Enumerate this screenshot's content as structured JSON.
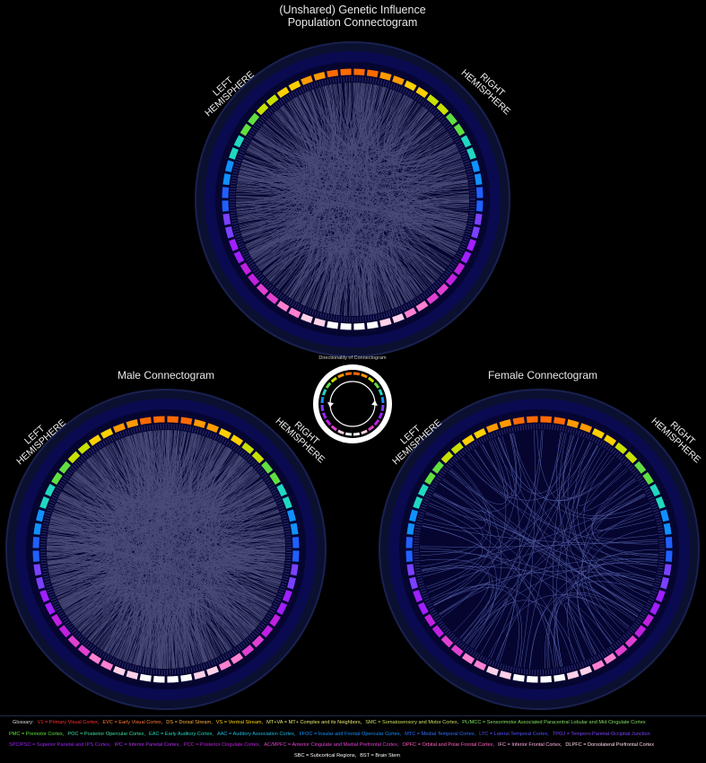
{
  "titles": {
    "main_line1": "(Unshared) Genetic Influence",
    "main_line2": "Population Connectogram",
    "male": "Male Connectogram",
    "female": "Female Connectogram",
    "directionality": "Directionality of Connectogram"
  },
  "hemispheres": {
    "left": "LEFT\nHEMISPHERE",
    "right": "RIGHT\nHEMISPHERE"
  },
  "connectograms": [
    {
      "name": "population",
      "edge_density": 0.75
    },
    {
      "name": "male",
      "edge_density": 1.0
    },
    {
      "name": "female",
      "edge_density": 0.12
    }
  ],
  "segment_colors": [
    "#ff6a00",
    "#ff9a00",
    "#ffd000",
    "#c8e000",
    "#60e040",
    "#20d8c0",
    "#1090ff",
    "#2060ff",
    "#7a40ff",
    "#a020ff",
    "#c020e0",
    "#e040d0",
    "#ff80d0",
    "#ffd0e8",
    "#ffffff"
  ],
  "glossary": {
    "prefix": "Glossary:",
    "line1": [
      {
        "text": "V1 = Primary Visual Cortex,",
        "color": "#ff3030"
      },
      {
        "text": "EVC = Early Visual Cortex,",
        "color": "#ff7a30"
      },
      {
        "text": "DS = Dorsal Stream,",
        "color": "#ffb040"
      },
      {
        "text": "VS = Ventral Stream,",
        "color": "#ffd000"
      },
      {
        "text": "MT+VA = MT+ Complex and its Neighbors,",
        "color": "#e8e870"
      },
      {
        "text": "SMC = Somatosensory and Motor Cortex,",
        "color": "#c8e060"
      },
      {
        "text": "PL/MCC = Sensorimotor Associated Paracentral Lobular and Mid Cingulate Cortex",
        "color": "#80e060"
      }
    ],
    "line2": [
      {
        "text": "PMC = Premotor Cortex,",
        "color": "#60e040"
      },
      {
        "text": "POC = Posterior Opercular Cortex,",
        "color": "#40e0a0"
      },
      {
        "text": "EAC = Early Auditory Cortex,",
        "color": "#20d8c0"
      },
      {
        "text": "AAC = Auditory Association Cortex,",
        "color": "#20b8e0"
      },
      {
        "text": "I/FOC = Insular and Frontal Opercular Cortex,",
        "color": "#1090ff"
      },
      {
        "text": "MTC = Medial Temporal Cortex,",
        "color": "#3070ff"
      },
      {
        "text": "LTC = Lateral Temporal Cortex,",
        "color": "#5050ff"
      },
      {
        "text": "TPOJ = Temporo-Parietal-Occipital Junction",
        "color": "#7a40ff"
      }
    ],
    "line3": [
      {
        "text": "SPC/PSC = Superior Parietal and IPS Cortex,",
        "color": "#a020ff"
      },
      {
        "text": "IPC = Inferior Parietal Cortex,",
        "color": "#b030f0"
      },
      {
        "text": "PCC = Posterior Cingulate Cortex,",
        "color": "#c020e0"
      },
      {
        "text": "AC/MPFC = Anterior Cingulate and Medial Prefrontal Cortex,",
        "color": "#e040d0"
      },
      {
        "text": "OPFC = Orbital and Polar Frontal Cortex,",
        "color": "#ff60c0"
      },
      {
        "text": "IFC = Inferior Frontal Cortex,",
        "color": "#ffb0e0"
      },
      {
        "text": "DLPFC = Dorsolateral Prefrontal Cortex",
        "color": "#ffd8ee"
      }
    ],
    "line4": [
      {
        "text": "SBC = Subcortical Regions,",
        "color": "#ffffff"
      },
      {
        "text": "BST = Brain Stem",
        "color": "#ffffff"
      }
    ]
  }
}
